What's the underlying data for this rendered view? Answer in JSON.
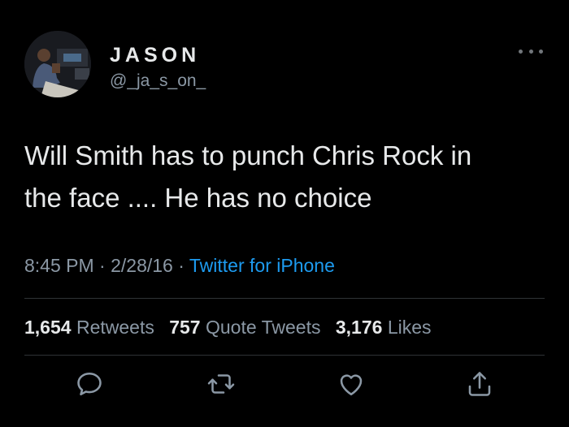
{
  "user": {
    "display_name": "JASON",
    "handle": "@_ja_s_on_"
  },
  "tweet": {
    "text_line1": "Will Smith has to punch Chris Rock in",
    "text_line2": "the face .... He has no choice",
    "time": "8:45 PM",
    "separator": "·",
    "date": "2/28/16",
    "source": "Twitter for iPhone"
  },
  "stats": {
    "retweets_count": "1,654",
    "retweets_label": "Retweets",
    "quotes_count": "757",
    "quotes_label": "Quote Tweets",
    "likes_count": "3,176",
    "likes_label": "Likes"
  },
  "icons": {
    "more": "more-horizontal-icon",
    "reply": "reply-icon",
    "retweet": "retweet-icon",
    "like": "heart-icon",
    "share": "share-icon"
  },
  "colors": {
    "background": "#000000",
    "text": "#e7e9ea",
    "secondary": "#8b98a5",
    "link": "#1d9bf0",
    "divider": "#2f3336"
  }
}
